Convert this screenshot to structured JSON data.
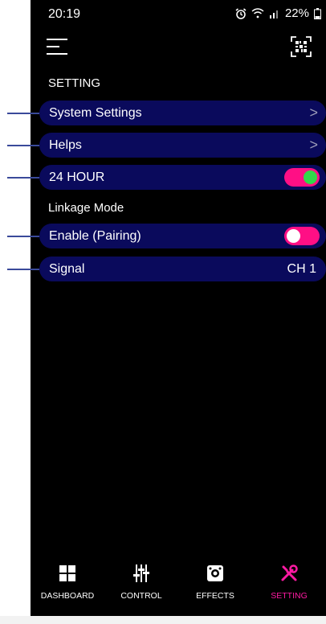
{
  "status": {
    "time": "20:19",
    "battery": "22%"
  },
  "header": {
    "section_title": "SETTING"
  },
  "rows": [
    {
      "label": "System Settings"
    },
    {
      "label": "Helps"
    },
    {
      "label": "24 HOUR",
      "toggle": true
    },
    {
      "label": "Enable (Pairing)",
      "toggle": false
    },
    {
      "label": "Signal",
      "value": "CH 1"
    }
  ],
  "linkage": {
    "title": "Linkage Mode"
  },
  "nav": [
    {
      "label": "DASHBOARD",
      "icon": "dashboard-grid-icon"
    },
    {
      "label": "CONTROL",
      "icon": "sliders-icon"
    },
    {
      "label": "EFFECTS",
      "icon": "effects-icon"
    },
    {
      "label": "SETTING",
      "icon": "wrench-screwdriver-icon",
      "active": true
    }
  ],
  "colors": {
    "row_bg": "#0a0a5c",
    "toggle_track": "#ff0f85",
    "toggle_knob_on": "#31d94a",
    "active_tab": "#ff1aa3"
  }
}
